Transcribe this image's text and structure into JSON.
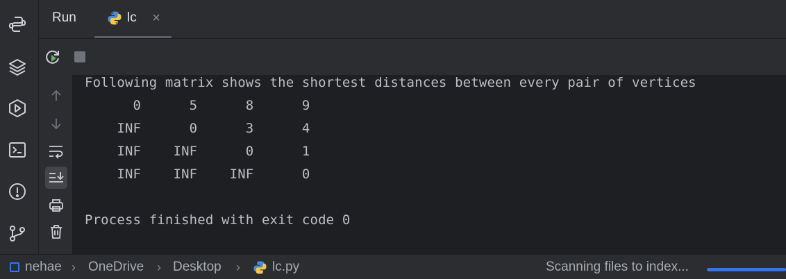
{
  "tabbar": {
    "run_label": "Run",
    "tab": {
      "label": "lc",
      "icon": "python-icon",
      "close_icon": "close-icon"
    }
  },
  "left_strip": {
    "icons": [
      "python-console-icon",
      "layers-icon",
      "services-icon",
      "terminal-icon",
      "problems-icon",
      "git-icon"
    ]
  },
  "toolbar": {
    "icons": [
      "rerun-icon",
      "stop-icon"
    ]
  },
  "side_actions": {
    "icons": [
      "up-arrow-icon",
      "down-arrow-icon",
      "soft-wrap-icon",
      "scroll-to-end-icon",
      "print-icon",
      "trash-icon"
    ],
    "active": "scroll-to-end-icon"
  },
  "console": {
    "lines": [
      "Following matrix shows the shortest distances between every pair of vertices",
      "      0      5      8      9",
      "    INF      0      3      4",
      "    INF    INF      0      1",
      "    INF    INF    INF      0",
      "",
      "Process finished with exit code 0"
    ]
  },
  "statusbar": {
    "breadcrumbs": [
      "nehae",
      "OneDrive",
      "Desktop",
      "lc.py"
    ],
    "status_text": "Scanning files to index...",
    "progress": 1.0
  },
  "colors": {
    "background": "#1e1f22",
    "panel": "#2b2d30",
    "text": "#bcbec4",
    "accent": "#3574f0"
  }
}
